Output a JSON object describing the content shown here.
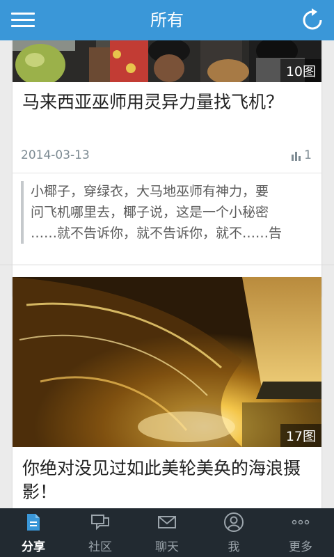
{
  "header": {
    "title": "所有"
  },
  "feed": [
    {
      "image_count": "10图",
      "title": "马来西亚巫师用灵异力量找飞机？",
      "date": "2014-03-13",
      "views": "1",
      "excerpt_lines": [
        "小椰子，穿绿衣，大马地巫师有神力，要",
        "问飞机哪里去，椰子说，这是一个小秘密",
        "……就不告诉你，就不告诉你，就不……告"
      ]
    },
    {
      "image_count": "17图",
      "title": "你绝对没见过如此美轮美奂的海浪摄影！"
    }
  ],
  "tabs": [
    {
      "label": "分享",
      "icon": "share-icon",
      "active": true
    },
    {
      "label": "社区",
      "icon": "community-icon"
    },
    {
      "label": "聊天",
      "icon": "mail-icon"
    },
    {
      "label": "我",
      "icon": "profile-icon"
    },
    {
      "label": "更多",
      "icon": "more-icon"
    }
  ],
  "colors": {
    "header": "#3a97d8",
    "tabbar": "#222a31",
    "active_tab_icon": "#3a97d8"
  }
}
